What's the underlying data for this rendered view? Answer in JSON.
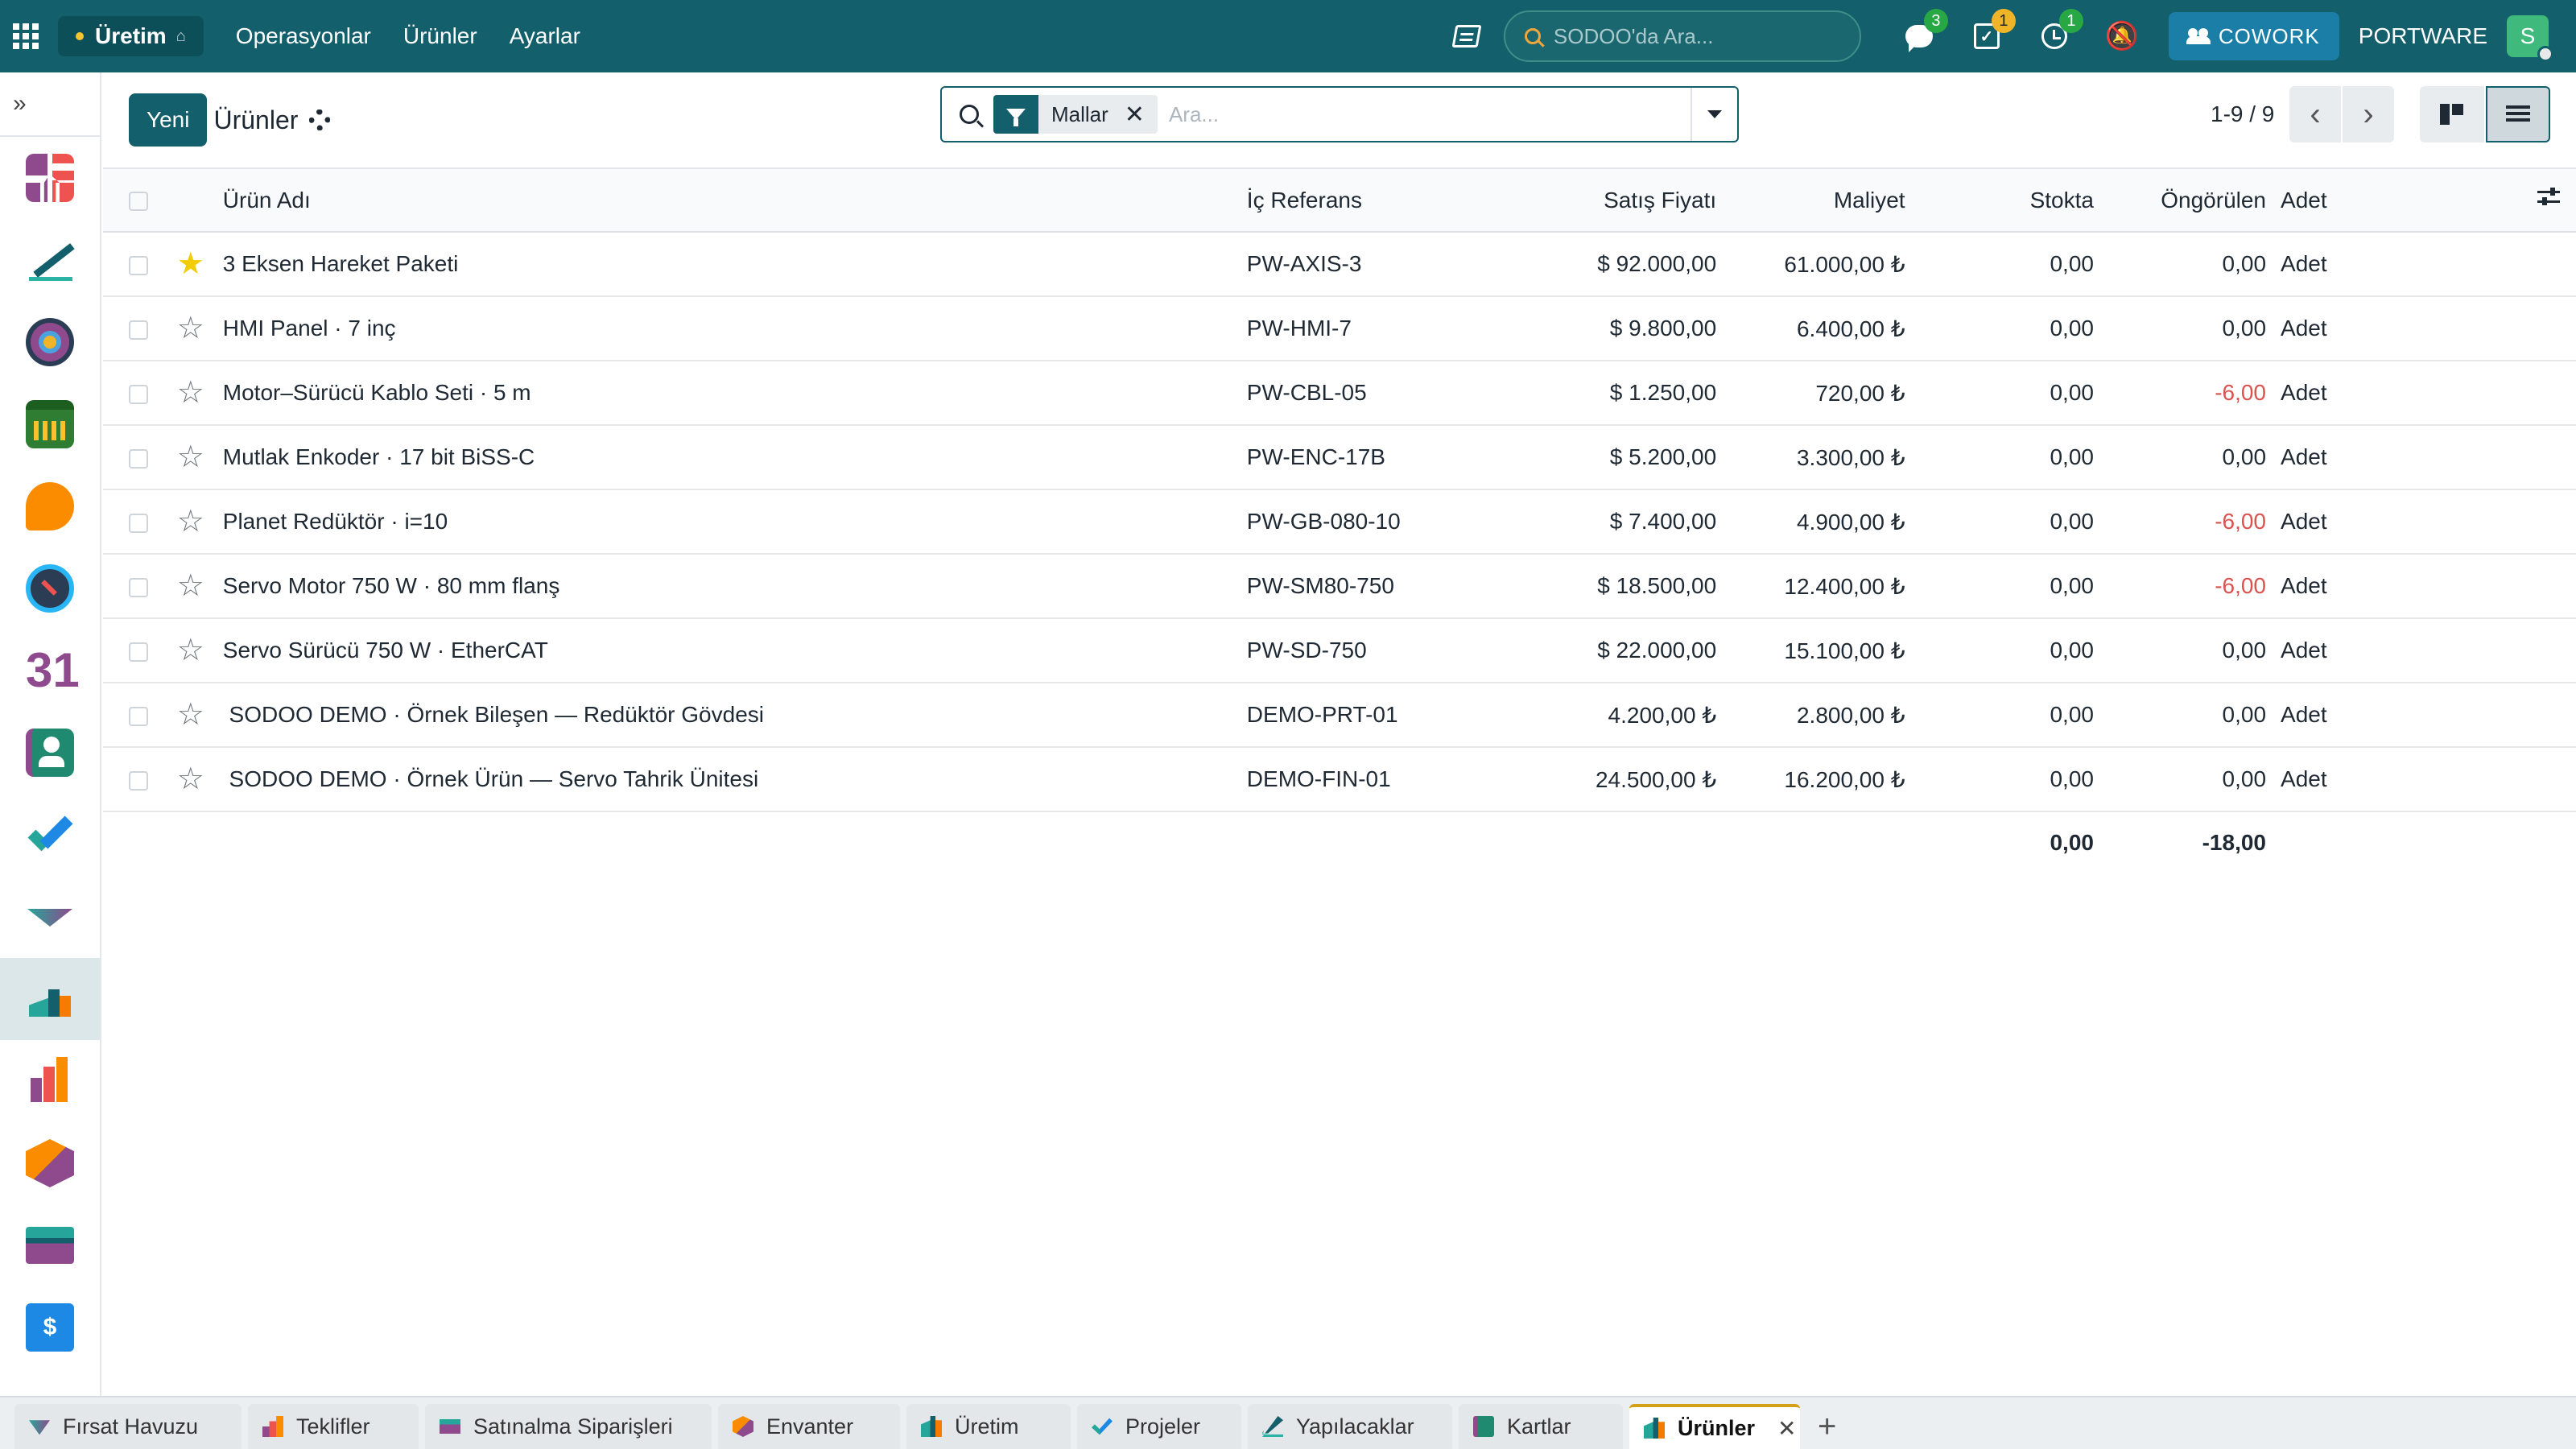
{
  "topbar": {
    "app_name": "Üretim",
    "menu": [
      "Operasyonlar",
      "Ürünler",
      "Ayarlar"
    ],
    "search_placeholder": "SODOO'da Ara...",
    "messages_count": "3",
    "todo_count": "1",
    "activity_count": "1",
    "cowork_label": "COWORK",
    "company": "PORTWARE",
    "user_initial": "S"
  },
  "control_panel": {
    "new_button": "Yeni",
    "title": "Ürünler",
    "filter_facet": "Mallar",
    "search_placeholder": "Ara...",
    "pager": "1-9 / 9"
  },
  "table": {
    "headers": {
      "name": "Ürün Adı",
      "ref": "İç Referans",
      "sale": "Satış Fiyatı",
      "cost": "Maliyet",
      "stock": "Stokta",
      "forecast": "Öngörülen",
      "unit": "Adet"
    },
    "rows": [
      {
        "starred": true,
        "name": "3 Eksen Hareket Paketi",
        "ref": "PW-AXIS-3",
        "sale": "$ 92.000,00",
        "cost": "61.000,00 ₺",
        "stock": "0,00",
        "forecast": "0,00",
        "unit": "Adet"
      },
      {
        "starred": false,
        "name": "HMI Panel · 7 inç",
        "ref": "PW-HMI-7",
        "sale": "$ 9.800,00",
        "cost": "6.400,00 ₺",
        "stock": "0,00",
        "forecast": "0,00",
        "unit": "Adet"
      },
      {
        "starred": false,
        "name": "Motor–Sürücü Kablo Seti · 5 m",
        "ref": "PW-CBL-05",
        "sale": "$ 1.250,00",
        "cost": "720,00 ₺",
        "stock": "0,00",
        "forecast": "-6,00",
        "unit": "Adet"
      },
      {
        "starred": false,
        "name": "Mutlak Enkoder · 17 bit BiSS-C",
        "ref": "PW-ENC-17B",
        "sale": "$ 5.200,00",
        "cost": "3.300,00 ₺",
        "stock": "0,00",
        "forecast": "0,00",
        "unit": "Adet"
      },
      {
        "starred": false,
        "name": "Planet Redüktör · i=10",
        "ref": "PW-GB-080-10",
        "sale": "$ 7.400,00",
        "cost": "4.900,00 ₺",
        "stock": "0,00",
        "forecast": "-6,00",
        "unit": "Adet"
      },
      {
        "starred": false,
        "name": "Servo Motor 750 W · 80 mm flanş",
        "ref": "PW-SM80-750",
        "sale": "$ 18.500,00",
        "cost": "12.400,00 ₺",
        "stock": "0,00",
        "forecast": "-6,00",
        "unit": "Adet"
      },
      {
        "starred": false,
        "name": "Servo Sürücü 750 W · EtherCAT",
        "ref": "PW-SD-750",
        "sale": "$ 22.000,00",
        "cost": "15.100,00 ₺",
        "stock": "0,00",
        "forecast": "0,00",
        "unit": "Adet"
      },
      {
        "starred": false,
        "name": "󠁿 SODOO DEMO · Örnek Bileşen — Redüktör Gövdesi",
        "ref": "DEMO-PRT-01",
        "sale": "4.200,00 ₺",
        "cost": "2.800,00 ₺",
        "stock": "0,00",
        "forecast": "0,00",
        "unit": "Adet"
      },
      {
        "starred": false,
        "name": "󠁿 SODOO DEMO · Örnek Ürün — Servo Tahrik Ünitesi",
        "ref": "DEMO-FIN-01",
        "sale": "24.500,00 ₺",
        "cost": "16.200,00 ₺",
        "stock": "0,00",
        "forecast": "0,00",
        "unit": "Adet"
      }
    ],
    "totals": {
      "stock": "0,00",
      "forecast": "-18,00"
    }
  },
  "bottom_tabs": [
    "Fırsat Havuzu",
    "Teklifler",
    "Satınalma Siparişleri",
    "Envanter",
    "Üretim",
    "Projeler",
    "Yapılacaklar",
    "Kartlar",
    "Ürünler"
  ],
  "colors": {
    "brand": "#135f6b",
    "negative": "#d9534f",
    "star": "#f3cc00"
  }
}
